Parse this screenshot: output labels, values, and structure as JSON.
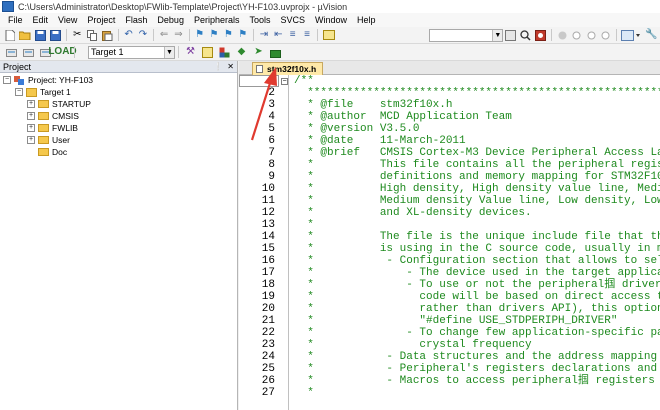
{
  "window": {
    "title": "C:\\Users\\Administrator\\Desktop\\FWlib-Template\\Project\\YH-F103.uvprojx - µVision"
  },
  "menu": [
    "File",
    "Edit",
    "View",
    "Project",
    "Flash",
    "Debug",
    "Peripherals",
    "Tools",
    "SVCS",
    "Window",
    "Help"
  ],
  "toolbar": {
    "target_select": "Target 1"
  },
  "project_panel": {
    "title": "Project",
    "pin": "❕",
    "close": "✕",
    "project_label": "Project: YH-F103",
    "target_label": "Target 1",
    "groups": [
      "STARTUP",
      "CMSIS",
      "FWLIB",
      "User",
      "Doc"
    ]
  },
  "editor": {
    "tab_label": "stm32f10x.h",
    "fold_marker": "−",
    "lines": [
      {
        "n": "1",
        "text": "/**"
      },
      {
        "n": "2",
        "text": "  ******************************************************************************"
      },
      {
        "n": "3",
        "text": "  * @file    stm32f10x.h"
      },
      {
        "n": "4",
        "text": "  * @author  MCD Application Team"
      },
      {
        "n": "5",
        "text": "  * @version V3.5.0"
      },
      {
        "n": "6",
        "text": "  * @date    11-March-2011"
      },
      {
        "n": "7",
        "text": "  * @brief   CMSIS Cortex-M3 Device Peripheral Access La"
      },
      {
        "n": "8",
        "text": "  *          This file contains all the peripheral regis"
      },
      {
        "n": "9",
        "text": "  *          definitions and memory mapping for STM32F10"
      },
      {
        "n": "10",
        "text": "  *          High density, High density value line, Medi"
      },
      {
        "n": "11",
        "text": "  *          Medium density Value line, Low density, Low"
      },
      {
        "n": "12",
        "text": "  *          and XL-density devices."
      },
      {
        "n": "13",
        "text": "  *"
      },
      {
        "n": "14",
        "text": "  *          The file is the unique include file that th"
      },
      {
        "n": "15",
        "text": "  *          is using in the C source code, usually in m"
      },
      {
        "n": "16",
        "text": "  *           - Configuration section that allows to sel"
      },
      {
        "n": "17",
        "text": "  *              - The device used in the target applica"
      },
      {
        "n": "18",
        "text": "  *              - To use or not the peripheral掴 driver"
      },
      {
        "n": "19",
        "text": "  *                code will be based on direct access t"
      },
      {
        "n": "20",
        "text": "  *                rather than drivers API), this option"
      },
      {
        "n": "21",
        "text": "  *                \"#define USE_STDPERIPH_DRIVER\""
      },
      {
        "n": "22",
        "text": "  *              - To change few application-specific pa"
      },
      {
        "n": "23",
        "text": "  *                crystal frequency"
      },
      {
        "n": "24",
        "text": "  *           - Data structures and the address mapping"
      },
      {
        "n": "25",
        "text": "  *           - Peripheral's registers declarations and"
      },
      {
        "n": "26",
        "text": "  *           - Macros to access peripheral掴 registers"
      },
      {
        "n": "27",
        "text": "  *"
      }
    ]
  },
  "colors": {
    "comment": "#1e8a1e",
    "tab_active": "#ffe9a8",
    "annotation_arrow": "#e03a2f"
  },
  "icons": {
    "toolbar1": [
      "new-file-icon",
      "open-icon",
      "save-icon",
      "save-all-icon",
      "cut-icon",
      "copy-icon",
      "paste-icon",
      "undo-icon",
      "redo-icon",
      "nav-back-icon",
      "nav-forward-icon",
      "bookmark-icon",
      "bookmark-prev-icon",
      "bookmark-next-icon",
      "bookmark-clear-icon",
      "indent-icon",
      "unindent-icon",
      "comment-icon",
      "uncomment-icon",
      "find-in-files-icon",
      "find-icon",
      "search-icon",
      "debug-icon",
      "breakpoint-icon",
      "breakpoint-disable-icon",
      "breakpoint-kill-icon",
      "window-layout-icon",
      "config-icon"
    ],
    "toolbar2": [
      "translate-icon",
      "build-icon",
      "rebuild-icon",
      "download-icon",
      "target-options-icon",
      "file-extensions-icon",
      "manage-packs-icon",
      "run-time-env-icon",
      "pack-installer-icon"
    ]
  }
}
